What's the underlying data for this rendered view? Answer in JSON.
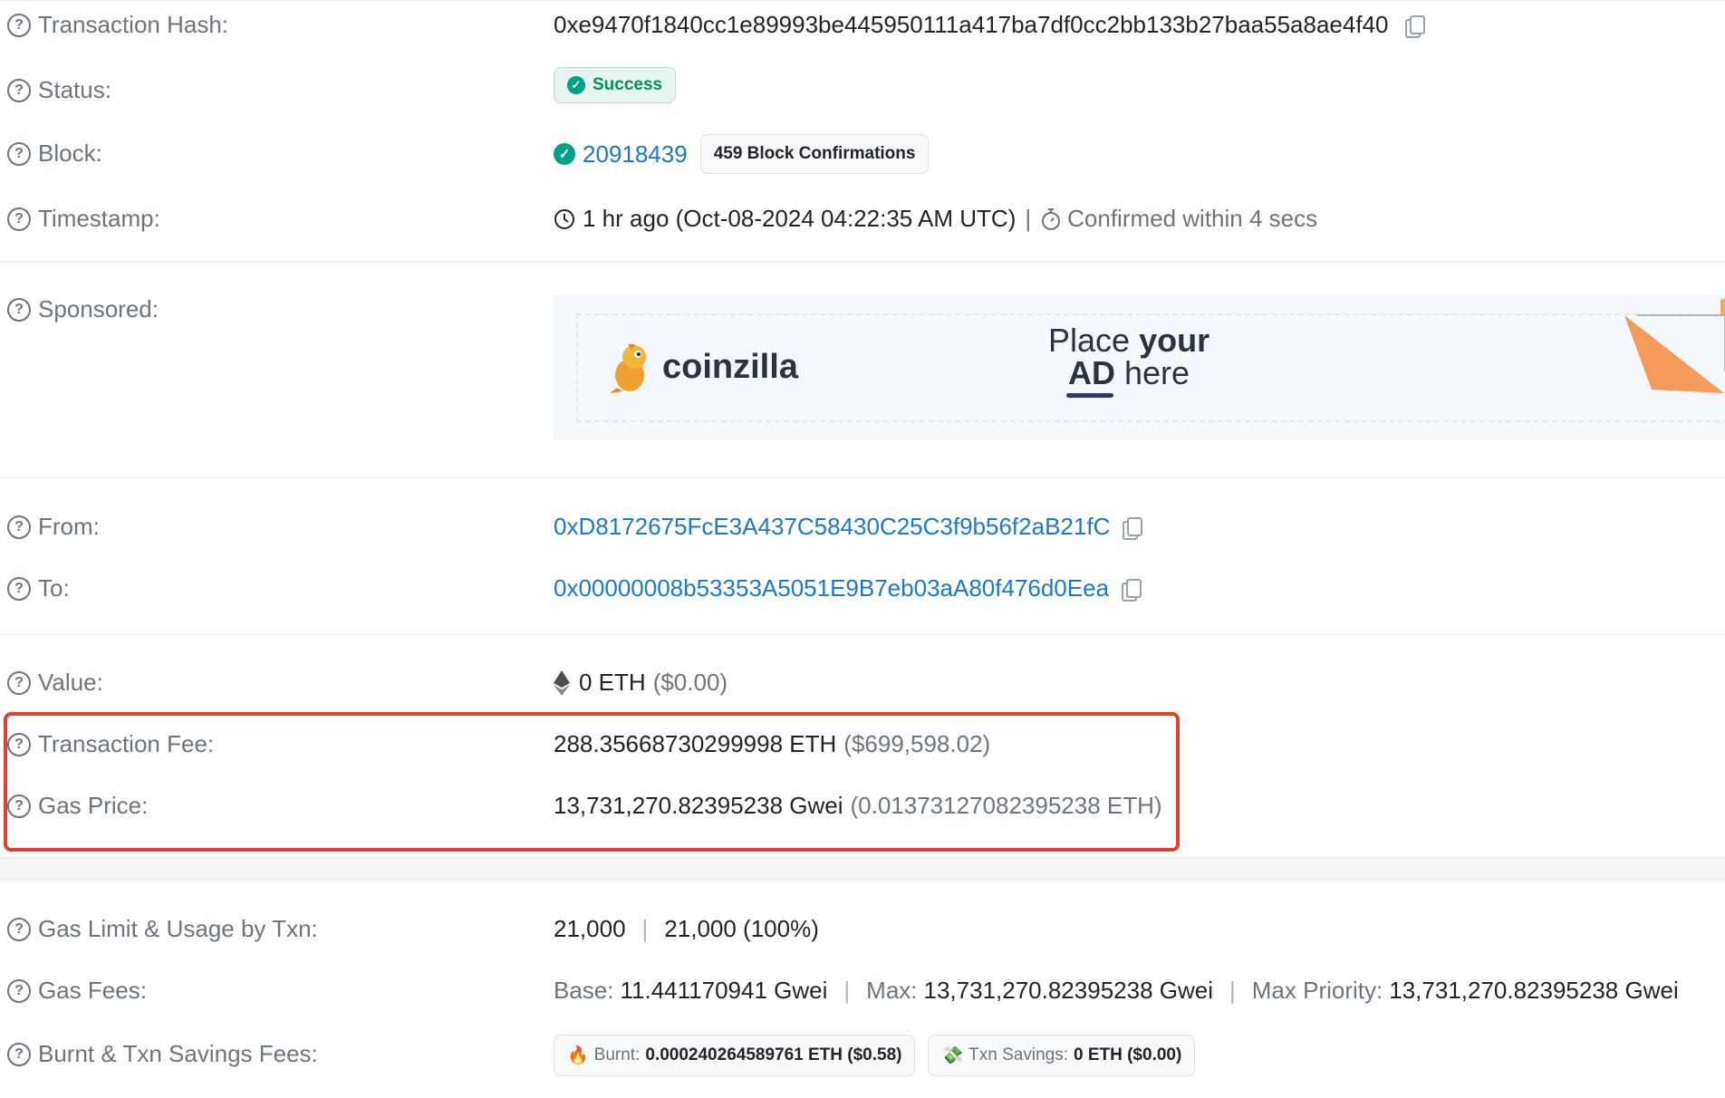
{
  "rows": {
    "tx_hash": {
      "label": "Transaction Hash:",
      "value": "0xe9470f1840cc1e89993be445950111a417ba7df0cc2bb133b27baa55a8ae4f40"
    },
    "status": {
      "label": "Status:",
      "value": "Success"
    },
    "block": {
      "label": "Block:",
      "number": "20918439",
      "confirmations": "459 Block Confirmations"
    },
    "timestamp": {
      "label": "Timestamp:",
      "value": "1 hr ago (Oct-08-2024 04:22:35 AM UTC)",
      "separator": "|",
      "confirmed": "Confirmed within 4 secs"
    },
    "sponsored": {
      "label": "Sponsored:",
      "brand": "coinzilla",
      "ad_line1_a": "Place",
      "ad_line1_b": "your",
      "ad_line2_a": "AD",
      "ad_line2_b": "here"
    },
    "from": {
      "label": "From:",
      "value": "0xD8172675FcE3A437C58430C25C3f9b56f2aB21fC"
    },
    "to": {
      "label": "To:",
      "value": "0x00000008b53353A5051E9B7eb03aA80f476d0Eea"
    },
    "value": {
      "label": "Value:",
      "amount": "0 ETH",
      "usd": "($0.00)"
    },
    "tx_fee": {
      "label": "Transaction Fee:",
      "amount": "288.35668730299998 ETH",
      "usd": "($699,598.02)"
    },
    "gas_price": {
      "label": "Gas Price:",
      "amount": "13,731,270.82395238 Gwei",
      "eth": "(0.01373127082395238 ETH)"
    },
    "gas_limit": {
      "label": "Gas Limit & Usage by Txn:",
      "limit": "21,000",
      "separator": "|",
      "usage": "21,000 (100%)"
    },
    "gas_fees": {
      "label": "Gas Fees:",
      "base_label": "Base:",
      "base_value": "11.441170941 Gwei",
      "max_label": "Max:",
      "max_value": "13,731,270.82395238 Gwei",
      "priority_label": "Max Priority:",
      "priority_value": "13,731,270.82395238 Gwei",
      "separator": "|"
    },
    "burnt": {
      "label": "Burnt & Txn Savings Fees:",
      "burnt_label": "Burnt:",
      "burnt_value": "0.000240264589761 ETH ($0.58)",
      "savings_label": "Txn Savings:",
      "savings_value": "0 ETH ($0.00)"
    }
  },
  "colors": {
    "link": "#1a79c8",
    "success": "#00925b",
    "highlight": "#e0412e",
    "ad_accent": "#f59a5b"
  }
}
